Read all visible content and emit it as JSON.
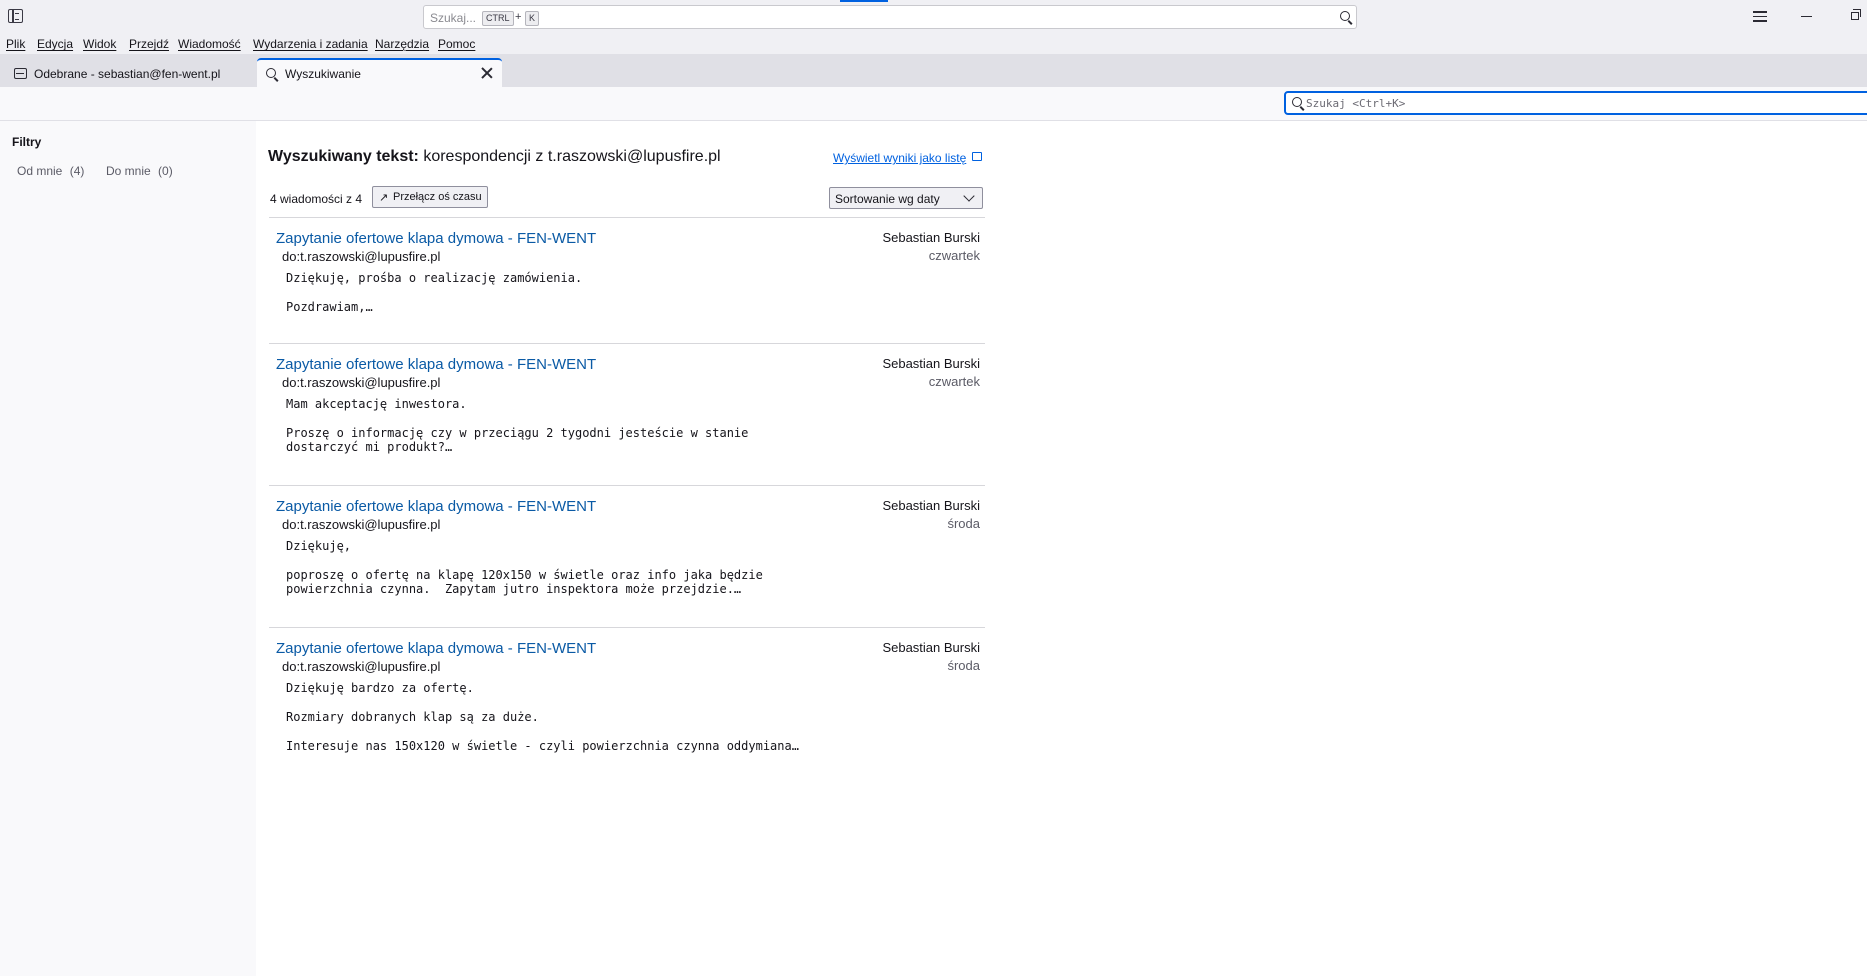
{
  "titlebar": {
    "search_placeholder": "Szukaj...",
    "shortcut_ctrl": "CTRL",
    "shortcut_plus": "+",
    "shortcut_key": "K"
  },
  "menu": [
    "Plik",
    "Edycja",
    "Widok",
    "Przejdź",
    "Wiadomość",
    "Wydarzenia i zadania",
    "Narzędzia",
    "Pomoc"
  ],
  "tabs": [
    {
      "label": "Odebrane - sebastian@fen-went.pl",
      "icon": "inbox-icon"
    },
    {
      "label": "Wyszukiwanie",
      "icon": "search-icon"
    }
  ],
  "findbar": {
    "placeholder": "Szukaj <Ctrl+K>"
  },
  "filters": {
    "title": "Filtry",
    "items": [
      {
        "label": "Od mnie",
        "count": "(4)"
      },
      {
        "label": "Do mnie",
        "count": "(0)"
      }
    ]
  },
  "results": {
    "heading_label": "Wyszukiwany tekst:",
    "heading_query": "korespondencji z t.raszowski@lupusfire.pl",
    "view_as_list": "Wyświetl wyniki jako listę",
    "count": "4 wiadomości z 4",
    "timeline_button": "Przełącz oś czasu",
    "timeline_icon": "↗",
    "sort_value": "Sortowanie wg daty",
    "messages": [
      {
        "subject": "Zapytanie ofertowe klapa dymowa - FEN-WENT",
        "to": "do:t.raszowski@lupusfire.pl",
        "sender": "Sebastian Burski",
        "date": "czwartek",
        "body": "Dziękuję, prośba o realizację zamówienia.\n\nPozdrawiam,…"
      },
      {
        "subject": "Zapytanie ofertowe klapa dymowa - FEN-WENT",
        "to": "do:t.raszowski@lupusfire.pl",
        "sender": "Sebastian Burski",
        "date": "czwartek",
        "body": "Mam akceptację inwestora.\n\nProszę o informację czy w przeciągu 2 tygodni jesteście w stanie\ndostarczyć mi produkt?…"
      },
      {
        "subject": "Zapytanie ofertowe klapa dymowa - FEN-WENT",
        "to": "do:t.raszowski@lupusfire.pl",
        "sender": "Sebastian Burski",
        "date": "środa",
        "body": "Dziękuję,\n\npoproszę o ofertę na klapę 120x150 w świetle oraz info jaka będzie\npowierzchnia czynna.  Zapytam jutro inspektora może przejdzie.…"
      },
      {
        "subject": "Zapytanie ofertowe klapa dymowa - FEN-WENT",
        "to": "do:t.raszowski@lupusfire.pl",
        "sender": "Sebastian Burski",
        "date": "środa",
        "body": "Dziękuję bardzo za ofertę.\n\nRozmiary dobranych klap są za duże.\n\nInteresuje nas 150x120 w świetle - czyli powierzchnia czynna oddymiana…"
      }
    ]
  }
}
